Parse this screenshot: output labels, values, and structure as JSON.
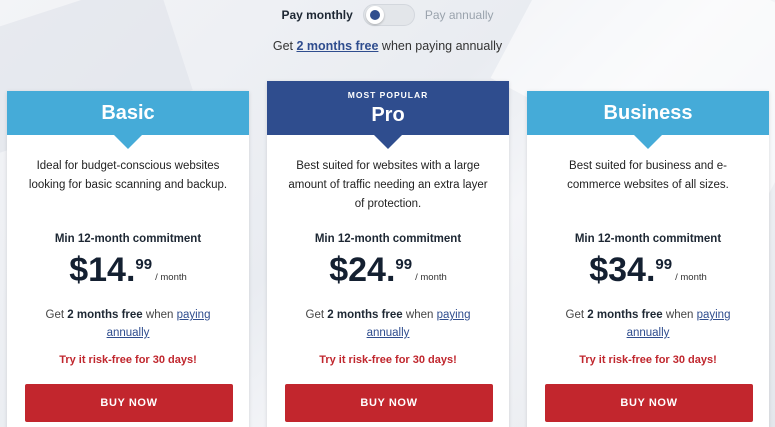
{
  "billing": {
    "monthly_label": "Pay monthly",
    "annually_label": "Pay annually",
    "selected": "monthly",
    "promo_prefix": "Get ",
    "promo_highlight": "2 months free",
    "promo_suffix": " when paying annually"
  },
  "plans": [
    {
      "name": "Basic",
      "tag": "",
      "description": "Ideal for budget-conscious websites looking for basic scanning and backup.",
      "commitment": "Min 12-month commitment",
      "price_whole": "$14.",
      "price_cents": "99",
      "price_period": "/ month",
      "save_prefix": "Get ",
      "save_bold": "2 months free",
      "save_mid": " when ",
      "save_link": "paying annually",
      "risk_free": "Try it risk-free for 30 days!",
      "button": "BUY NOW"
    },
    {
      "name": "Pro",
      "tag": "MOST POPULAR",
      "description": "Best suited for websites with a large amount of traffic needing an extra layer of protection.",
      "commitment": "Min 12-month commitment",
      "price_whole": "$24.",
      "price_cents": "99",
      "price_period": "/ month",
      "save_prefix": "Get ",
      "save_bold": "2 months free",
      "save_mid": " when ",
      "save_link": "paying annually",
      "risk_free": "Try it risk-free for 30 days!",
      "button": "BUY NOW"
    },
    {
      "name": "Business",
      "tag": "",
      "description": "Best suited for business and e-commerce websites of all sizes.",
      "commitment": "Min 12-month commitment",
      "price_whole": "$34.",
      "price_cents": "99",
      "price_period": "/ month",
      "save_prefix": "Get ",
      "save_bold": "2 months free",
      "save_mid": " when ",
      "save_link": "paying annually",
      "risk_free": "Try it risk-free for 30 days!",
      "button": "BUY NOW"
    }
  ],
  "colors": {
    "basic_header": "#45abd8",
    "pro_header": "#2f4d8e",
    "business_header": "#45abd8",
    "buy_button": "#c2262d",
    "risk_text": "#c0262d"
  }
}
